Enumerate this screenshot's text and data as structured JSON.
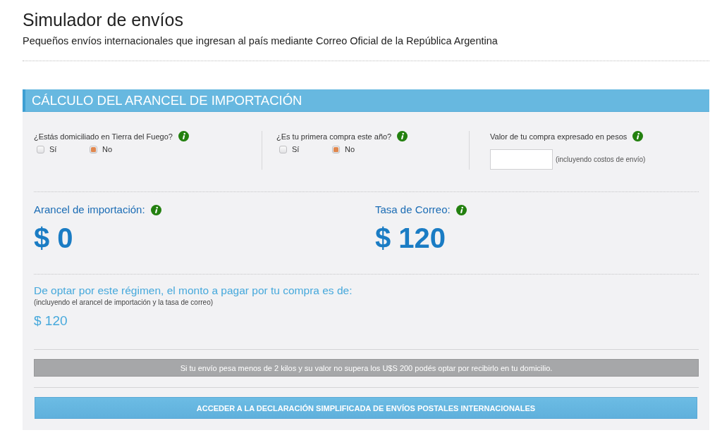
{
  "page": {
    "title": "Simulador de envíos",
    "subtitle": "Pequeños envíos internacionales que ingresan al país mediante Correo Oficial de la República Argentina"
  },
  "calculator": {
    "title": "CÁLCULO DEL ARANCEL DE IMPORTACIÓN",
    "questions": [
      {
        "label": "¿Estás domiciliado en Tierra del Fuego?",
        "options": [
          {
            "label": "Sí",
            "selected": false
          },
          {
            "label": "No",
            "selected": true
          }
        ]
      },
      {
        "label": "¿Es tu primera compra este año?",
        "options": [
          {
            "label": "Sí",
            "selected": false
          },
          {
            "label": "No",
            "selected": true
          }
        ]
      }
    ],
    "purchase_value": {
      "label": "Valor de tu compra expresado en pesos",
      "note": "(incluyendo costos de envío)"
    },
    "results": [
      {
        "label": "Arancel de importación:",
        "amount": "$ 0"
      },
      {
        "label": "Tasa de Correo:",
        "amount": "$ 120"
      }
    ],
    "total": {
      "label": "De optar por este régimen, el monto a pagar por tu compra es de:",
      "note": "(incluyendo el arancel de importación y la tasa de correo)",
      "amount": "$ 120"
    },
    "notice": "Si tu envío pesa menos de 2 kilos y su valor no supera los U$S 200 podés optar por recibirlo en tu domicilio.",
    "action_button": "ACCEDER A LA DECLARACIÓN SIMPLIFICADA DE ENVÍOS POSTALES INTERNACIONALES"
  }
}
